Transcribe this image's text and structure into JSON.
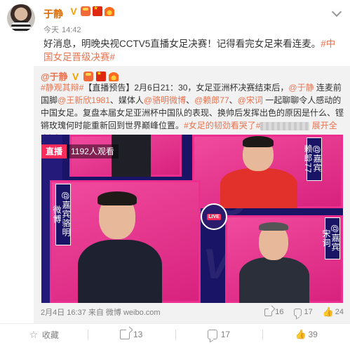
{
  "post": {
    "author": "于静",
    "time_label": "今天",
    "time": "14:42",
    "text_main": "好消息，明晚央视CCTV5直播女足决赛！记得看完女足来看连麦。",
    "hashtag": "#中国女足晋级决赛#"
  },
  "repost": {
    "author": "@于静",
    "topic": "#静观其辩#",
    "body_1": "【直播预告】2月6日21：30，女足亚洲杯决赛结束后，",
    "mention_1": "@于静",
    "body_2": " 连麦前国脚",
    "mention_2": "@王新欣1981",
    "body_3": "、媒体人",
    "mention_3": "@骆明微博",
    "body_4": "、",
    "mention_4": "@赖郎77",
    "body_5": "、",
    "mention_5": "@宋词",
    "body_6": " 一起聊聊令人感动的中国女足。复盘本届女足亚洲杯中国队的表现、换帅后发挥出色的原因是什么、铿锵玫瑰何时能重新回到世界巅峰位置。",
    "hashtag": "#女足的韧劲看哭了#",
    "expand": "展开全文",
    "expand_arrow": "﹀",
    "time": "2月4日 16:37 来自 微博 weibo.com",
    "stats": {
      "forwards": "16",
      "comments": "17",
      "likes": "24"
    },
    "image": {
      "live_tag": "直播",
      "viewers": "1192人观看",
      "live_button": "LIVE",
      "guest_right_top": {
        "at": "@",
        "role": "嘉宾",
        "name": "赖郎77"
      },
      "guest_left": {
        "at": "@",
        "role": "嘉宾",
        "name": "骆明微博"
      },
      "guest_right_bottom": {
        "at": "@",
        "role": "嘉宾",
        "name": "宋词"
      }
    }
  },
  "actions": {
    "favorite": "收藏",
    "forward": "13",
    "comment": "17",
    "like": "39"
  },
  "icons": {
    "v_badge": "verified-v-icon",
    "accent": "#eb7350",
    "username_color": "#e06b00"
  }
}
